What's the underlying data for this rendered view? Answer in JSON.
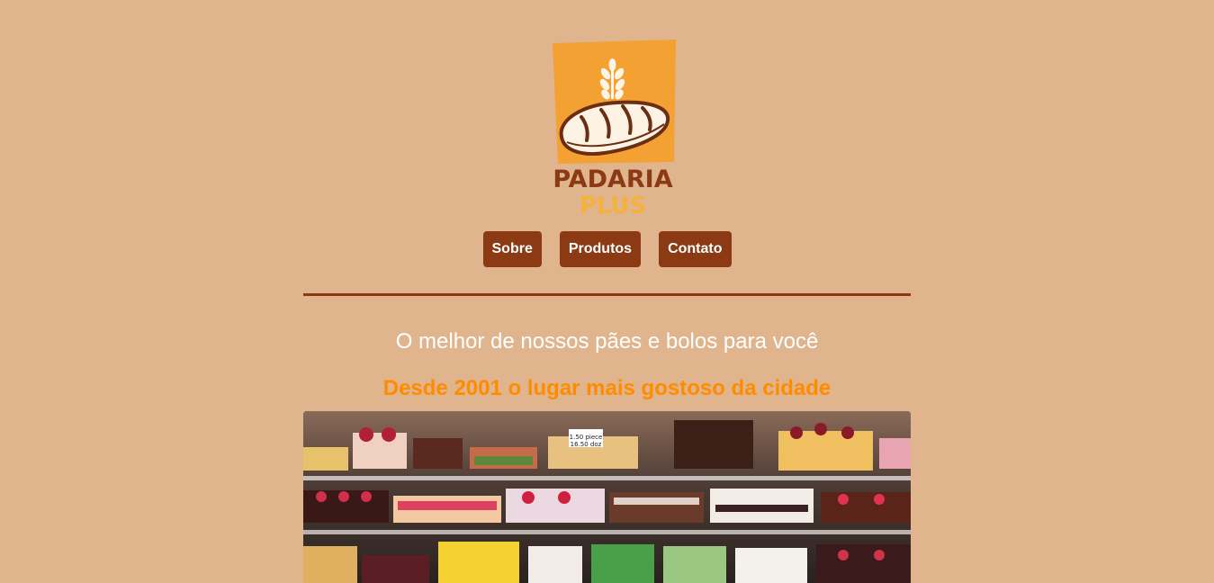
{
  "logo": {
    "line1": "PADARIA",
    "line2": "PLUS",
    "colors": {
      "badge": "#f4a133",
      "brown": "#8b3a14",
      "yellow": "#f4b23c"
    }
  },
  "nav": {
    "items": [
      {
        "label": "Sobre"
      },
      {
        "label": "Produtos"
      },
      {
        "label": "Contato"
      }
    ]
  },
  "hero": {
    "headline": "O melhor de nossos pães e bolos para você",
    "subheadline": "Desde 2001 o lugar mais gostoso da cidade"
  },
  "showcase": {
    "price_tag_line1": "1.50 piece",
    "price_tag_line2": "16.50 doz"
  },
  "theme": {
    "background": "#e0b48c",
    "accent": "#8b3a14",
    "highlight": "#ff8c00"
  }
}
